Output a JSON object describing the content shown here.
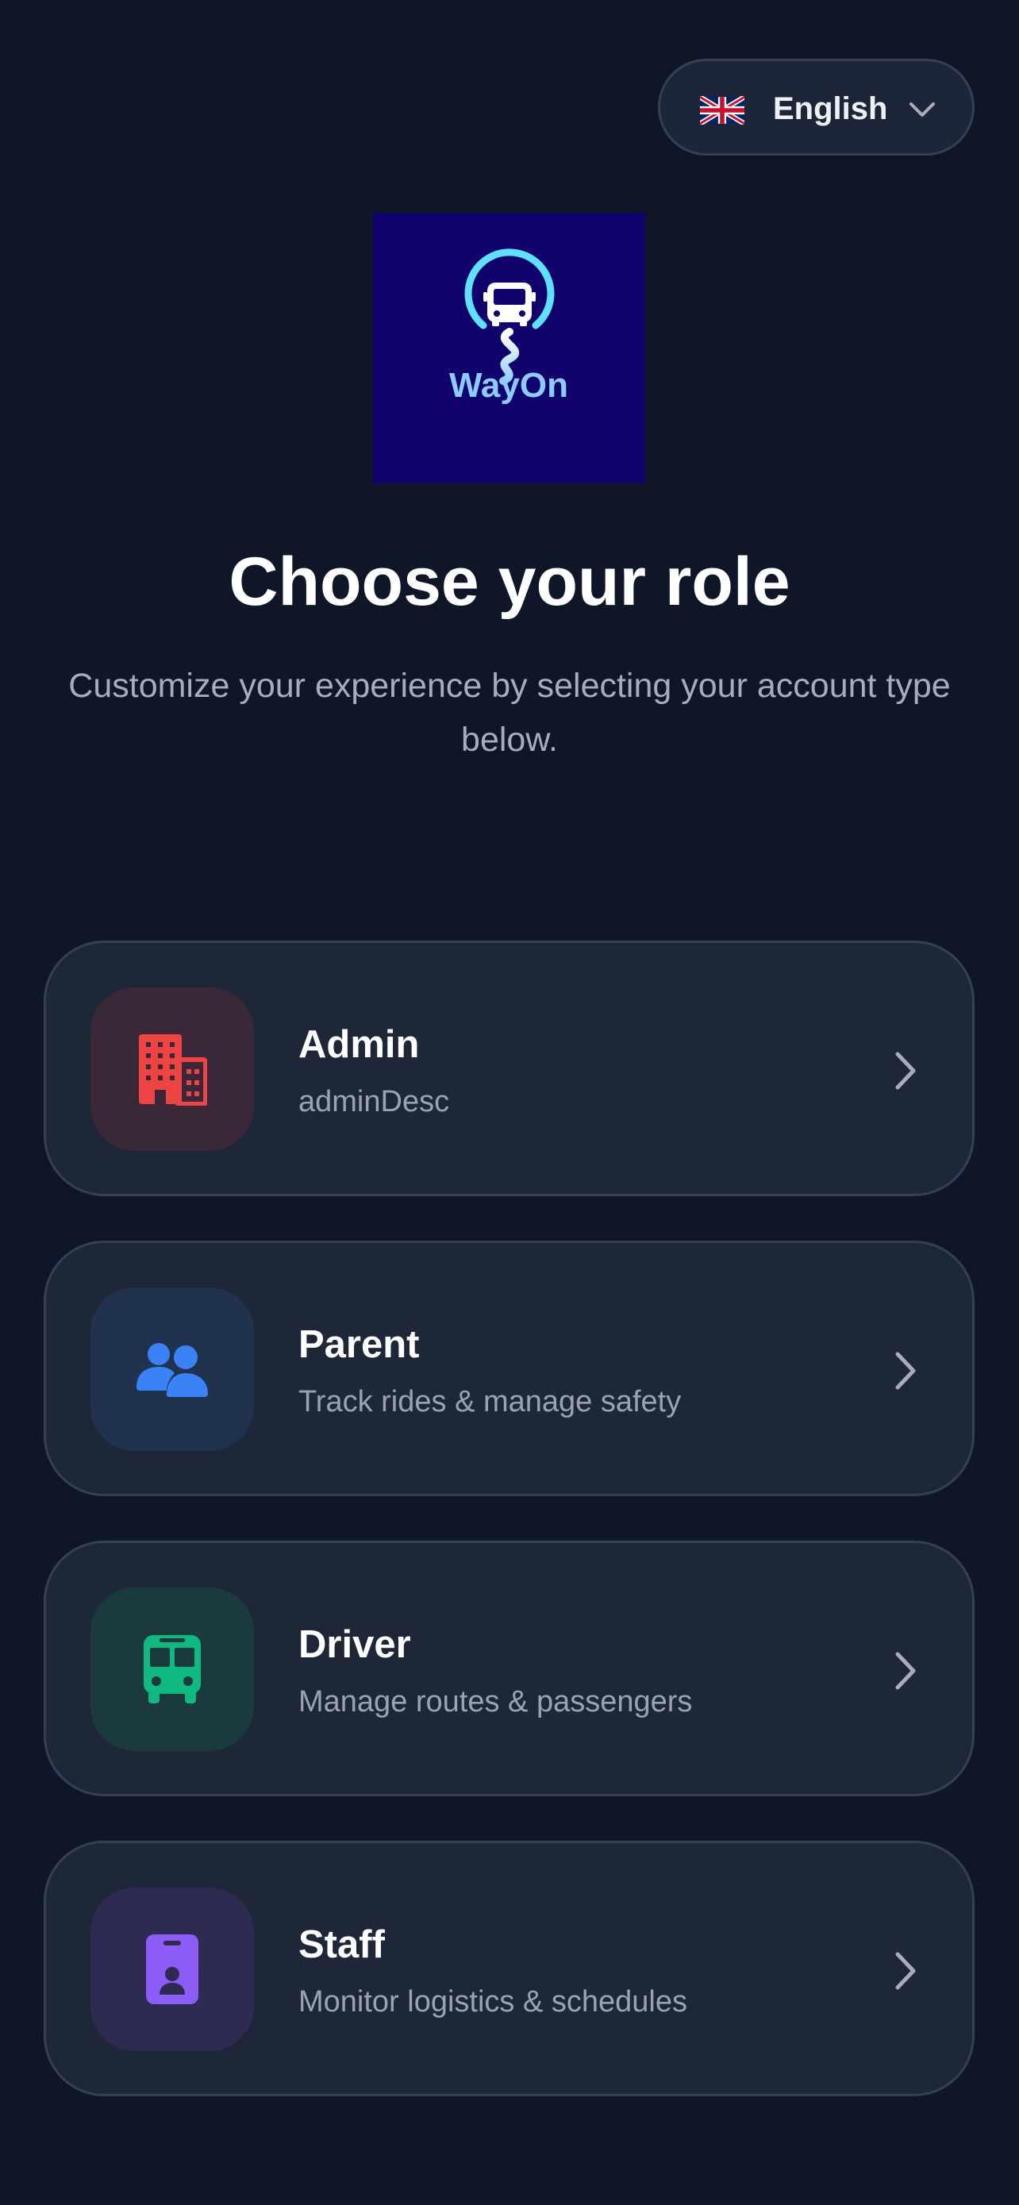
{
  "language": {
    "selected": "English",
    "flag_icon": "uk-flag-icon",
    "chevron_icon": "chevron-down-icon"
  },
  "logo": {
    "text": "WayOn",
    "background_color": "#10036b",
    "accent_color": "#5ee0ff"
  },
  "header": {
    "title": "Choose your role",
    "subtitle": "Customize your experience by selecting your account type below."
  },
  "roles": [
    {
      "title": "Admin",
      "description": "adminDesc",
      "icon": "building-icon",
      "icon_color": "#ef4444",
      "icon_bg": "#3a2737"
    },
    {
      "title": "Parent",
      "description": "Track rides & manage safety",
      "icon": "users-icon",
      "icon_color": "#3b82f6",
      "icon_bg": "#21324f"
    },
    {
      "title": "Driver",
      "description": "Manage routes & passengers",
      "icon": "bus-icon",
      "icon_color": "#10b981",
      "icon_bg": "#1b3a3d"
    },
    {
      "title": "Staff",
      "description": "Monitor logistics & schedules",
      "icon": "id-badge-icon",
      "icon_color": "#8b5cf6",
      "icon_bg": "#2d2b52"
    }
  ],
  "colors": {
    "background": "#0e1628",
    "card_background": "#1e2738",
    "card_border": "#334055"
  }
}
